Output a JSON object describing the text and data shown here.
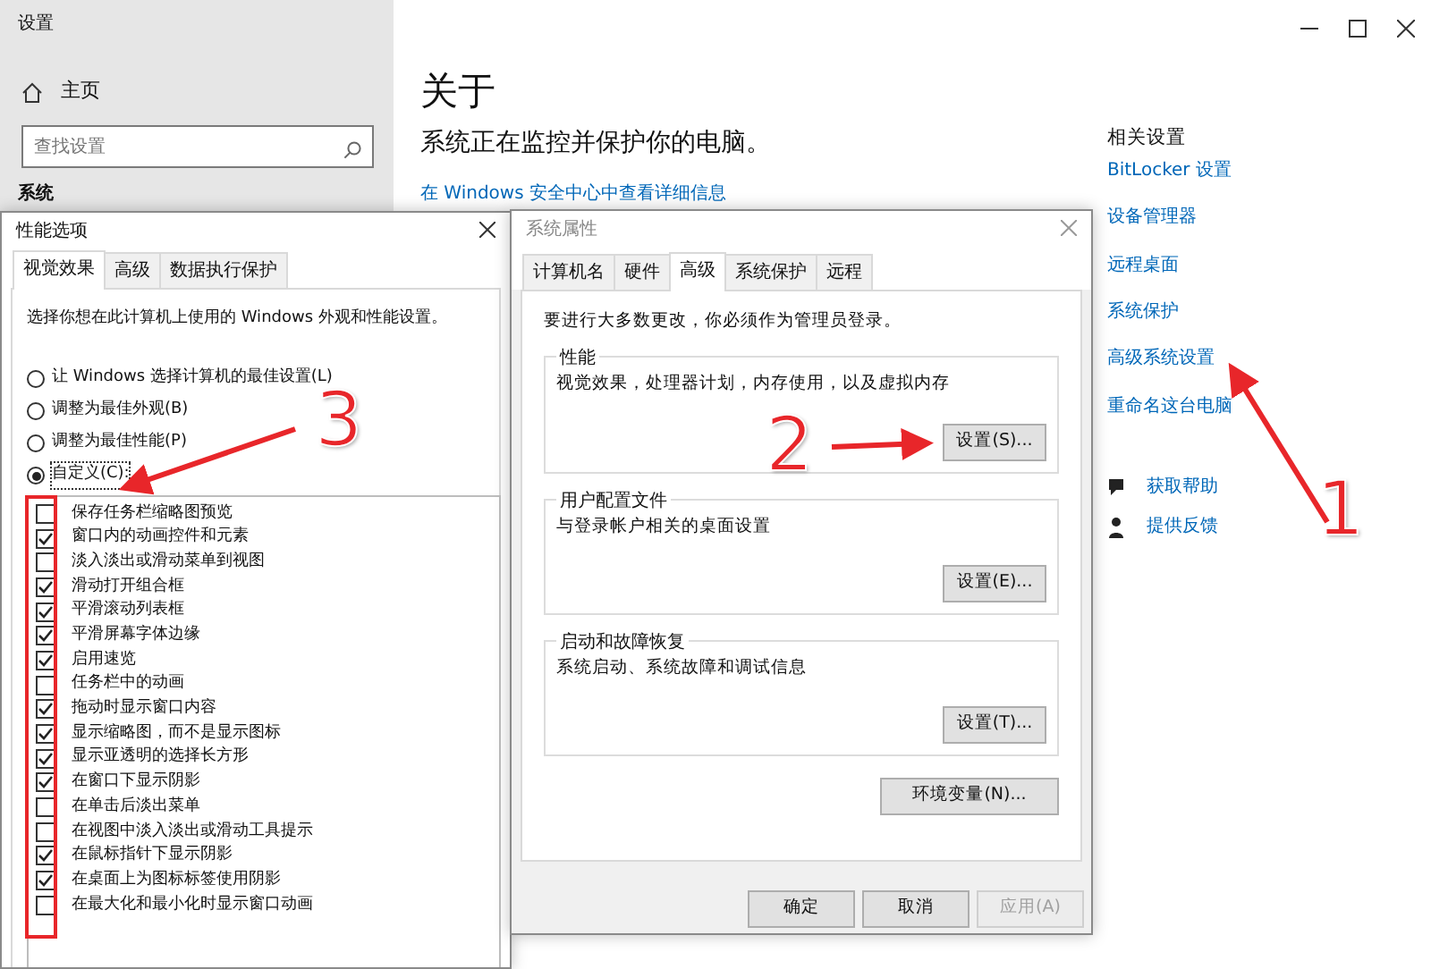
{
  "settings_window": {
    "title": "设置",
    "sidebar": {
      "home": "主页",
      "search_placeholder": "查找设置",
      "section": "系统"
    },
    "main": {
      "heading": "关于",
      "subheading": "系统正在监控并保护你的电脑。",
      "link": "在 Windows 安全中心中查看详细信息"
    },
    "related_settings": {
      "title": "相关设置",
      "links": [
        "BitLocker 设置",
        "设备管理器",
        "远程桌面",
        "系统保护",
        "高级系统设置",
        "重命名这台电脑"
      ]
    },
    "support_links": [
      {
        "kind": "help",
        "label": "获取帮助"
      },
      {
        "kind": "feedback",
        "label": "提供反馈"
      }
    ]
  },
  "performance_options": {
    "title": "性能选项",
    "tabs": [
      {
        "label": "视觉效果",
        "selected": true
      },
      {
        "label": "高级",
        "selected": false
      },
      {
        "label": "数据执行保护",
        "selected": false
      }
    ],
    "intro": "选择你想在此计算机上使用的 Windows 外观和性能设置。",
    "radios": [
      {
        "label": "让 Windows 选择计算机的最佳设置(L)",
        "selected": false
      },
      {
        "label": "调整为最佳外观(B)",
        "selected": false
      },
      {
        "label": "调整为最佳性能(P)",
        "selected": false
      },
      {
        "label": "自定义(C):",
        "selected": true
      }
    ],
    "effects": [
      {
        "label": "保存任务栏缩略图预览",
        "checked": false
      },
      {
        "label": "窗口内的动画控件和元素",
        "checked": true
      },
      {
        "label": "淡入淡出或滑动菜单到视图",
        "checked": false
      },
      {
        "label": "滑动打开组合框",
        "checked": true
      },
      {
        "label": "平滑滚动列表框",
        "checked": true
      },
      {
        "label": "平滑屏幕字体边缘",
        "checked": true
      },
      {
        "label": "启用速览",
        "checked": true
      },
      {
        "label": "任务栏中的动画",
        "checked": false
      },
      {
        "label": "拖动时显示窗口内容",
        "checked": true
      },
      {
        "label": "显示缩略图，而不是显示图标",
        "checked": true
      },
      {
        "label": "显示亚透明的选择长方形",
        "checked": true
      },
      {
        "label": "在窗口下显示阴影",
        "checked": true
      },
      {
        "label": "在单击后淡出菜单",
        "checked": false
      },
      {
        "label": "在视图中淡入淡出或滑动工具提示",
        "checked": false
      },
      {
        "label": "在鼠标指针下显示阴影",
        "checked": true
      },
      {
        "label": "在桌面上为图标标签使用阴影",
        "checked": true
      },
      {
        "label": "在最大化和最小化时显示窗口动画",
        "checked": false
      }
    ]
  },
  "system_properties": {
    "title": "系统属性",
    "tabs": [
      {
        "label": "计算机名",
        "selected": false
      },
      {
        "label": "硬件",
        "selected": false
      },
      {
        "label": "高级",
        "selected": true
      },
      {
        "label": "系统保护",
        "selected": false
      },
      {
        "label": "远程",
        "selected": false
      }
    ],
    "notice": "要进行大多数更改，你必须作为管理员登录。",
    "groups": [
      {
        "title": "性能",
        "description": "视觉效果，处理器计划，内存使用，以及虚拟内存",
        "button": "设置(S)..."
      },
      {
        "title": "用户配置文件",
        "description": "与登录帐户相关的桌面设置",
        "button": "设置(E)..."
      },
      {
        "title": "启动和故障恢复",
        "description": "系统启动、系统故障和调试信息",
        "button": "设置(T)..."
      }
    ],
    "env_button": "环境变量(N)...",
    "footer_buttons": [
      {
        "label": "确定",
        "disabled": false
      },
      {
        "label": "取消",
        "disabled": false
      },
      {
        "label": "应用(A)",
        "disabled": true
      }
    ]
  },
  "annotations": [
    {
      "label": "1"
    },
    {
      "label": "2"
    },
    {
      "label": "3"
    }
  ]
}
